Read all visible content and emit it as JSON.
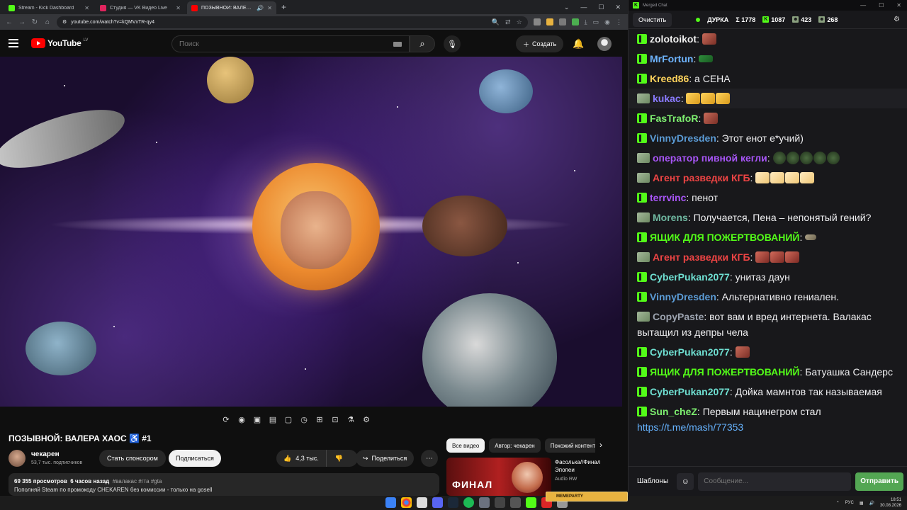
{
  "browser": {
    "tabs": [
      {
        "label": "Stream - Kick Dashboard",
        "color": "#53fc18",
        "active": false
      },
      {
        "label": "Студия — VK Видео Live",
        "color": "#e0245e",
        "active": false
      },
      {
        "label": "ПОЗЫВНОЙ: ВАЛЕРА ХАОС",
        "color": "#ff0000",
        "active": true
      }
    ],
    "new_tab": "+",
    "url": "youtube.com/watch?v=kQMVxTR-qy4"
  },
  "youtube": {
    "logo_text": "YouTube",
    "region": "LV",
    "search_placeholder": "Поиск",
    "create_label": "Создать",
    "video_title": "ПОЗЫВНОЙ: ВАЛЕРА ХАОС ♿ #1",
    "channel_name": "чекарен",
    "subscribers": "53,7 тыс. подписчиков",
    "sponsor_label": "Стать спонсором",
    "subscribe_label": "Подписаться",
    "likes": "4,3 тыс.",
    "share_label": "Поделиться",
    "views": "69 355 просмотров",
    "uploaded": "6 часов назад",
    "tags": "#валакас #гта #gta",
    "description": "Пополняй Steam по промокоду CHEKAREN без комиссии - только на gosell",
    "chips": [
      {
        "label": "Все видео",
        "active": true
      },
      {
        "label": "Автор: чекарен",
        "active": false
      },
      {
        "label": "Похожий контент",
        "active": false
      }
    ],
    "rec": {
      "thumb_label": "ФИНАЛ",
      "title": "Фасолька//Финал Эпопеи",
      "author": "Audio RW"
    }
  },
  "chat": {
    "window_title": "Merged Chat",
    "clear_label": "Очистить",
    "status": "ДУРКА",
    "stats": {
      "total": "Σ 1778",
      "kick": "1087",
      "vk": "423",
      "other": "268"
    },
    "messages": [
      {
        "platform": "kick",
        "user": "zolotoikot",
        "color": "#f0f0f0",
        "text": "",
        "emotes": [
          "e-face"
        ]
      },
      {
        "platform": "kick",
        "user": "MrFortun",
        "color": "#6eb4ff",
        "text": "",
        "emotes": [
          "e-frog"
        ]
      },
      {
        "platform": "kick",
        "user": "Kreed86",
        "color": "#ffd35c",
        "text": "а СЕНА",
        "emotes": []
      },
      {
        "platform": "vk",
        "user": "kukac",
        "color": "#8a7bff",
        "text": "",
        "emotes": [
          "e-laugh",
          "e-laugh",
          "e-laugh"
        ],
        "highlight": true
      },
      {
        "platform": "kick",
        "user": "FasTrafoR",
        "color": "#7ef070",
        "text": "",
        "emotes": [
          "e-face"
        ]
      },
      {
        "platform": "kick",
        "user": "VinnyDresden",
        "color": "#5b9bd5",
        "text": "Этот енот е*учий)",
        "emotes": []
      },
      {
        "platform": "vk",
        "user": "оператор пивной кегли",
        "color": "#a855f7",
        "text": "",
        "emotes": [
          "e-green",
          "e-green",
          "e-green",
          "e-green",
          "e-green"
        ]
      },
      {
        "platform": "vk",
        "user": "Агент разведки КГБ",
        "color": "#ef4444",
        "text": "",
        "emotes": [
          "e-pale",
          "e-pale",
          "e-pale",
          "e-pale"
        ]
      },
      {
        "platform": "kick",
        "user": "terrvinc",
        "color": "#a855f7",
        "text": "пенот",
        "emotes": []
      },
      {
        "platform": "vk",
        "user": "Morens",
        "color": "#6fb7a0",
        "text": "Получается, Пена – непонятый гений?",
        "emotes": []
      },
      {
        "platform": "kick",
        "user": "ЯЩИК ДЛЯ ПОЖЕРТВОВАНИЙ",
        "color": "#53fc18",
        "text": "",
        "emotes": [
          "e-pill"
        ]
      },
      {
        "platform": "vk",
        "user": "Агент разведки КГБ",
        "color": "#ef4444",
        "text": "",
        "emotes": [
          "e-red",
          "e-red",
          "e-red"
        ]
      },
      {
        "platform": "kick",
        "user": "CyberPukan2077",
        "color": "#6fe0d2",
        "text": "унитаз даун",
        "emotes": []
      },
      {
        "platform": "kick",
        "user": "VinnyDresden",
        "color": "#5b9bd5",
        "text": "Альтернативно гениален.",
        "emotes": []
      },
      {
        "platform": "vk",
        "user": "CopyPaste",
        "color": "#9ca3af",
        "text": "вот вам и вред интернета. Валакас вытащил из депры чела",
        "emotes": []
      },
      {
        "platform": "kick",
        "user": "CyberPukan2077",
        "color": "#6fe0d2",
        "text": "",
        "emotes": [
          "e-face"
        ]
      },
      {
        "platform": "kick",
        "user": "ЯЩИК ДЛЯ ПОЖЕРТВОВАНИЙ",
        "color": "#53fc18",
        "text": "Батуашка Сандерс",
        "emotes": []
      },
      {
        "platform": "kick",
        "user": "CyberPukan2077",
        "color": "#6fe0d2",
        "text": "Дойка мамнтов так называемая",
        "emotes": []
      },
      {
        "platform": "kick",
        "user": "Sun_cheZ",
        "color": "#7ef070",
        "text": "Первым нацинегром стал",
        "emotes": [],
        "link": "https://t.me/mash/77353"
      }
    ],
    "templates_label": "Шаблоны",
    "input_placeholder": "Сообщение...",
    "send_label": "Отправить"
  },
  "taskbar": {
    "popup": "MEMEPARTY",
    "lang": "РУС",
    "time": "18:51",
    "date": "30.08.2026"
  }
}
